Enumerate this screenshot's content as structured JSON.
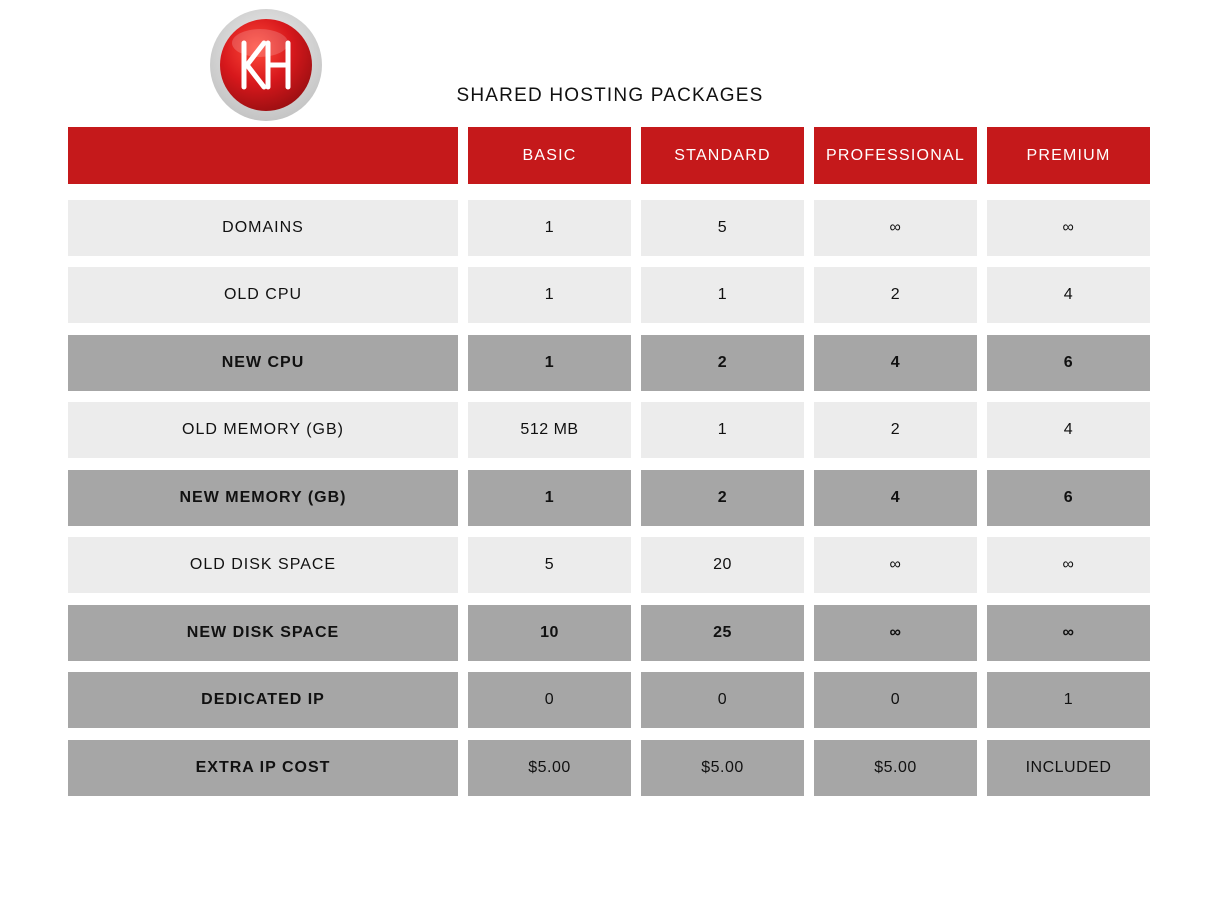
{
  "brand": {
    "logo_letters": "KH",
    "logo_colors": {
      "ring": "#cfcfcf",
      "disc": "#d7181c",
      "letters": "#ffffff"
    }
  },
  "title": "SHARED HOSTING PACKAGES",
  "header": {
    "corner_label": "",
    "columns": [
      "BASIC",
      "STANDARD",
      "PROFESSIONAL",
      "PREMIUM"
    ]
  },
  "rows": [
    {
      "label": "DOMAINS",
      "style": "light",
      "values": [
        "1",
        "5",
        "∞",
        "∞"
      ]
    },
    {
      "label": "OLD CPU",
      "style": "light",
      "values": [
        "1",
        "1",
        "2",
        "4"
      ]
    },
    {
      "label": "NEW CPU",
      "style": "dark",
      "values": [
        "1",
        "2",
        "4",
        "6"
      ]
    },
    {
      "label": "OLD MEMORY (GB)",
      "style": "light",
      "values": [
        "512 MB",
        "1",
        "2",
        "4"
      ]
    },
    {
      "label": "NEW MEMORY (GB)",
      "style": "dark",
      "values": [
        "1",
        "2",
        "4",
        "6"
      ]
    },
    {
      "label": "OLD DISK SPACE",
      "style": "light",
      "values": [
        "5",
        "20",
        "∞",
        "∞"
      ]
    },
    {
      "label": "NEW DISK SPACE",
      "style": "dark",
      "values": [
        "10",
        "25",
        "∞",
        "∞"
      ]
    },
    {
      "label": "DEDICATED IP",
      "style": "dark-plain",
      "values": [
        "0",
        "0",
        "0",
        "1"
      ]
    },
    {
      "label": "EXTRA IP COST",
      "style": "dark-plain",
      "values": [
        "$5.00",
        "$5.00",
        "$5.00",
        "INCLUDED"
      ]
    }
  ],
  "colors": {
    "header_red": "#c5191b",
    "row_light": "#ececec",
    "row_dark": "#a6a6a6"
  }
}
